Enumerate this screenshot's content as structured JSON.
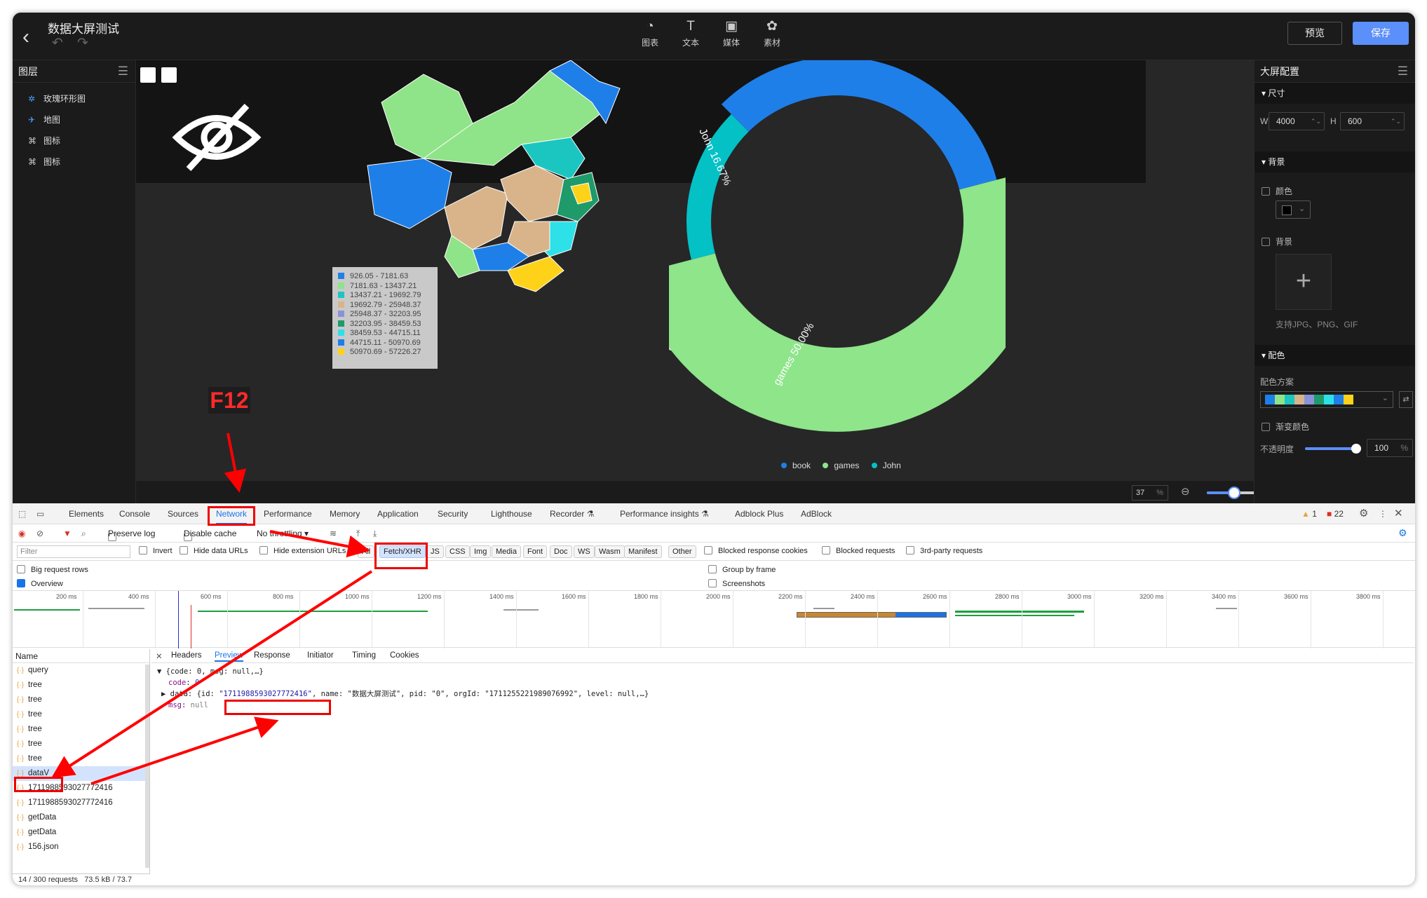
{
  "app": {
    "title": "数据大屏测试",
    "preview_label": "预览",
    "save_label": "保存",
    "tools": [
      {
        "icon": "chart-icon",
        "glyph": "◔",
        "label": "图表"
      },
      {
        "icon": "text-icon",
        "glyph": "T",
        "label": "文本"
      },
      {
        "icon": "media-icon",
        "glyph": "▣",
        "label": "媒体"
      },
      {
        "icon": "material-icon",
        "glyph": "✿",
        "label": "素材"
      }
    ]
  },
  "layers": {
    "title": "图层",
    "items": [
      {
        "label": "玫瑰环形图",
        "icon": "rose-chart-icon",
        "glyph": "✲"
      },
      {
        "label": "地图",
        "icon": "map-icon",
        "glyph": "✈"
      },
      {
        "label": "图标",
        "icon": "icon-layer-icon",
        "glyph": "⌘"
      },
      {
        "label": "图标",
        "icon": "icon-layer-icon",
        "glyph": "⌘"
      }
    ]
  },
  "canvas": {
    "map_legend": [
      {
        "label": "926.05 - 7181.63",
        "color": "#1e7fe8"
      },
      {
        "label": "7181.63 - 13437.21",
        "color": "#8fe388"
      },
      {
        "label": "13437.21 - 19692.79",
        "color": "#1cc6c0"
      },
      {
        "label": "19692.79 - 25948.37",
        "color": "#d9b48a"
      },
      {
        "label": "25948.37 - 32203.95",
        "color": "#8a93d8"
      },
      {
        "label": "32203.95 - 38459.53",
        "color": "#1f9a6a"
      },
      {
        "label": "38459.53 - 44715.11",
        "color": "#2ee0e8"
      },
      {
        "label": "44715.11 - 50970.69",
        "color": "#1e7fe8"
      },
      {
        "label": "50970.69 - 57226.27",
        "color": "#ffd21a"
      }
    ],
    "zoom_in": "+",
    "zoom_out": "−",
    "zoom_value": "37",
    "zoom_unit": "%",
    "zoom_slider_fraction": 0.3
  },
  "chart_data": {
    "type": "pie",
    "categories": [
      "book",
      "games",
      "John"
    ],
    "values": [
      33.33,
      50.0,
      16.67
    ],
    "slice_labels": [
      "",
      "games 50.00%",
      "John 16.67%"
    ],
    "colors": [
      "#1f7fe8",
      "#8ee58a",
      "#04c1c6"
    ],
    "legend": [
      "book",
      "games",
      "John"
    ],
    "legend_position": "bottom"
  },
  "config": {
    "title": "大屏配置",
    "size_section": "尺寸",
    "w_label": "W",
    "w_value": "4000",
    "h_label": "H",
    "h_value": "600",
    "bg_section": "背景",
    "color_label": "颜色",
    "bg_label": "背景",
    "upload_hint": "支持JPG、PNG、GIF",
    "palette_section": "配色",
    "palette_label": "配色方案",
    "palette_colors": [
      "#1e7fe8",
      "#8fe388",
      "#1cc6c0",
      "#d9b48a",
      "#8a93d8",
      "#1f9a6a",
      "#2ee0e8",
      "#1e7fe8",
      "#ffd21a"
    ],
    "gradient_label": "渐变颜色",
    "opacity_label": "不透明度",
    "opacity_value": "100",
    "opacity_unit": "%"
  },
  "devtools": {
    "tabs": [
      "Elements",
      "Console",
      "Sources",
      "Network",
      "Performance",
      "Memory",
      "Application",
      "Security",
      "Lighthouse",
      "Recorder ⚗",
      "Performance insights ⚗",
      "Adblock Plus",
      "AdBlock"
    ],
    "warnings": "1",
    "errors": "22",
    "toolbar": {
      "preserve_log": "Preserve log",
      "disable_cache": "Disable cache",
      "throttling": "No throttling"
    },
    "filter_placeholder": "Filter",
    "invert": "Invert",
    "hide_data_urls": "Hide data URLs",
    "hide_ext": "Hide extension URLs",
    "type_filters": [
      "All",
      "Fetch/XHR",
      "JS",
      "CSS",
      "Img",
      "Media",
      "Font",
      "Doc",
      "WS",
      "Wasm",
      "Manifest",
      "Other"
    ],
    "blocked_cookies": "Blocked response cookies",
    "blocked_requests": "Blocked requests",
    "third_party": "3rd-party requests",
    "big_rows": "Big request rows",
    "group_by_frame": "Group by frame",
    "overview": "Overview",
    "screenshots": "Screenshots",
    "timeline_labels": [
      "200 ms",
      "400 ms",
      "600 ms",
      "800 ms",
      "1000 ms",
      "1200 ms",
      "1400 ms",
      "1600 ms",
      "1800 ms",
      "2000 ms",
      "2200 ms",
      "2400 ms",
      "2600 ms",
      "2800 ms",
      "3000 ms",
      "3200 ms",
      "3400 ms",
      "3600 ms",
      "3800 ms"
    ],
    "name_header": "Name",
    "requests": [
      "query",
      "tree",
      "tree",
      "tree",
      "tree",
      "tree",
      "tree",
      "dataV",
      "1711988593027772416",
      "1711988593027772416",
      "getData",
      "getData",
      "156.json"
    ],
    "detail_tabs": [
      "Headers",
      "Preview",
      "Response",
      "Initiator",
      "Timing",
      "Cookies"
    ],
    "preview": {
      "line1": "▼ {code: 0, msg: null,…}",
      "code_key": "code",
      "code_val": "0",
      "data_prefix": "▶ data: {id: ",
      "data_id": "\"1711988593027772416\"",
      "data_rest": ", name: \"数据大屏测试\", pid: \"0\", orgId: \"1711255221989076992\", level: null,…}",
      "msg_key": "msg",
      "msg_val": "null"
    },
    "status": "14 / 300 requests",
    "transfer": "73.5 kB / 73.7"
  },
  "annotation": {
    "f12": "F12"
  }
}
